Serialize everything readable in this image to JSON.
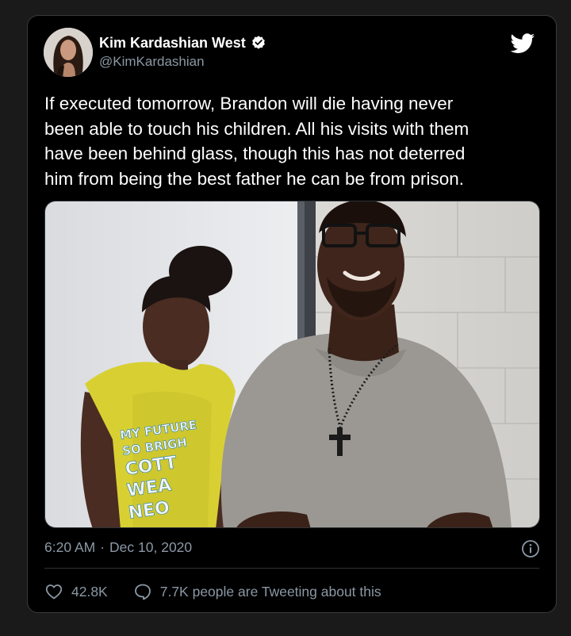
{
  "tweet": {
    "author": {
      "display_name": "Kim Kardashian West",
      "handle": "@KimKardashian",
      "verified": true
    },
    "text": "If executed tomorrow, Brandon will die having never\nbeen able to touch his children.  All his visits with them\nhave been behind glass, though this has not deterred\nhim from being the best father he can be from prison.",
    "photo": {
      "shirt_text_lines": [
        "MY FUTURE",
        "SO BRIGH",
        "COTT",
        "WEA",
        "NEO"
      ]
    },
    "time": "6:20 AM",
    "separator": "·",
    "date": "Dec 10, 2020",
    "likes": "42.8K",
    "conversation_label": "7.7K people are Tweeting about this"
  },
  "icons": {
    "brand": "twitter-bird-icon",
    "verified": "verified-badge-icon",
    "info": "info-icon",
    "like": "heart-icon",
    "reply": "speech-bubble-icon"
  },
  "colors": {
    "background": "#000000",
    "page_background": "#1a1a1a",
    "text_primary": "#ffffff",
    "text_secondary": "#8b98a5",
    "brand": "#ffffff",
    "verified_badge": "#ffffff",
    "divider": "#2f3336"
  }
}
